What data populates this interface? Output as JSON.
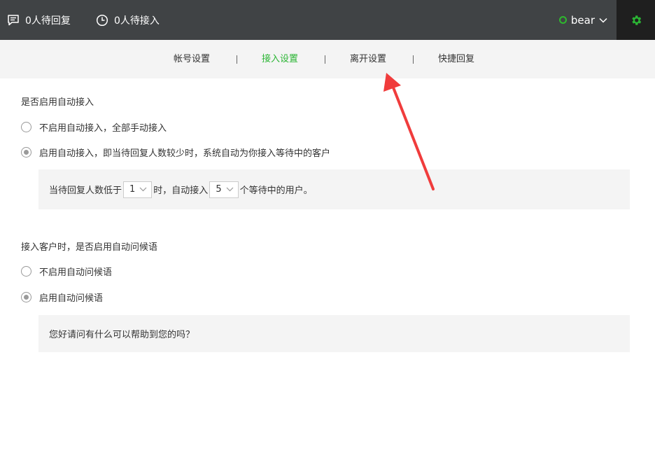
{
  "topbar": {
    "pending_reply": "0人待回复",
    "pending_access": "0人待接入",
    "user_name": "bear",
    "status_color": "#2eb82e",
    "settings_icon": "gear-icon"
  },
  "tabs": [
    {
      "label": "帐号设置",
      "active": false
    },
    {
      "label": "接入设置",
      "active": true
    },
    {
      "label": "离开设置",
      "active": false
    },
    {
      "label": "快捷回复",
      "active": false
    }
  ],
  "separator": "|",
  "auto_access": {
    "title": "是否启用自动接入",
    "option_off": "不启用自动接入，全部手动接入",
    "option_on": "启用自动接入，即当待回复人数较少时，系统自动为你接入等待中的客户",
    "selected": "on",
    "rule": {
      "prefix": "当待回复人数低于",
      "threshold": "1",
      "middle": "时，自动接入",
      "count": "5",
      "suffix": "个等待中的用户。"
    }
  },
  "greeting": {
    "title": "接入客户时，是否启用自动问候语",
    "option_off": "不启用自动问候语",
    "option_on": "启用自动问候语",
    "selected": "on",
    "text": "您好请问有什么可以帮助到您的吗？"
  },
  "accent_color": "#2bb534",
  "annotation_color": "#f03c3c"
}
